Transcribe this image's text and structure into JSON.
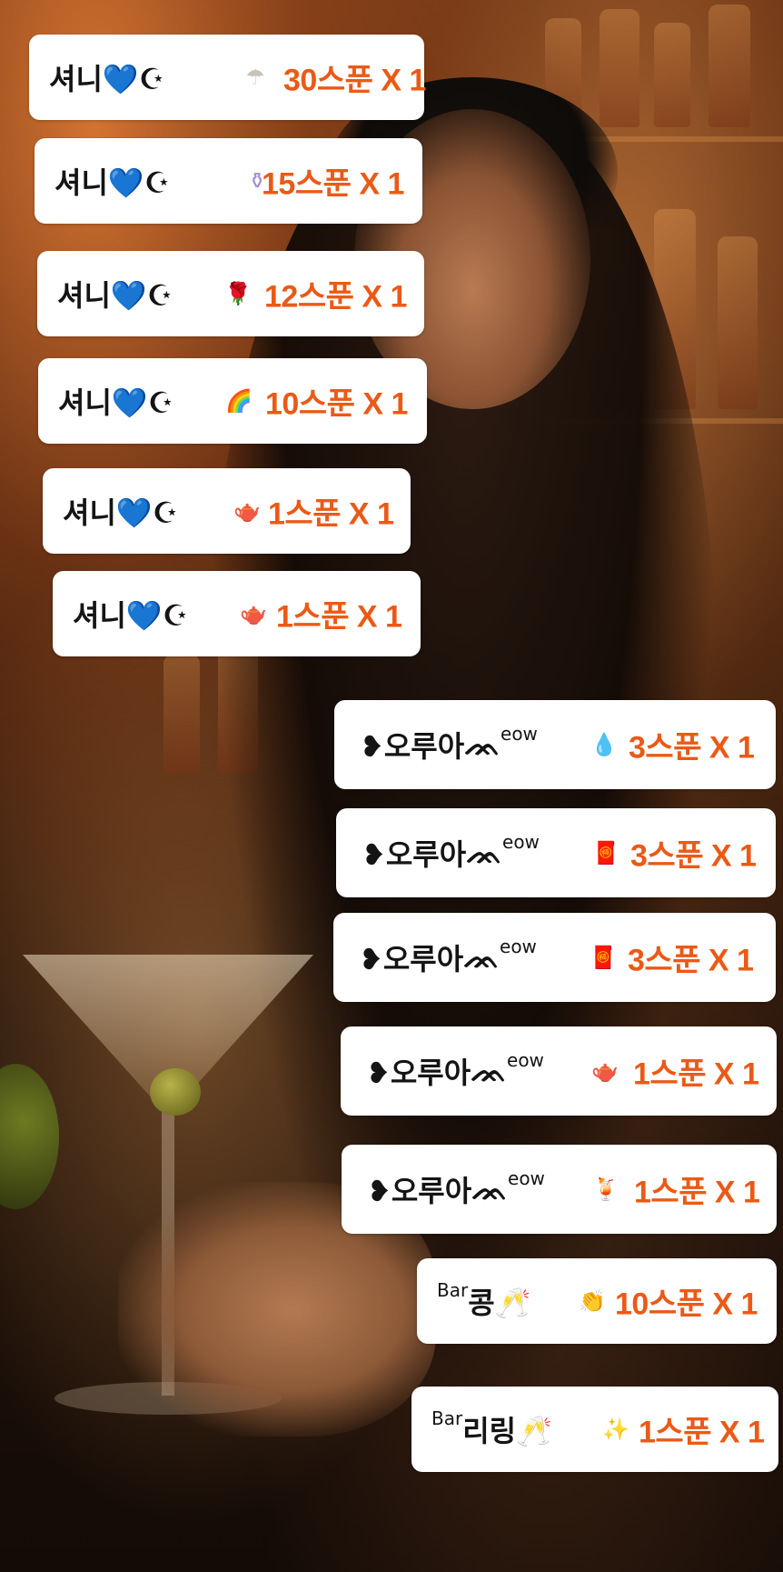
{
  "donations": [
    {
      "user": "셔니💙☪",
      "gift_icon": "umbrella-icon",
      "gift_glyph": "☂",
      "gift_color": "#c9c2b8",
      "amount": "30스푼 X 1"
    },
    {
      "user": "셔니💙☪",
      "gift_icon": "potion-bottle-icon",
      "gift_glyph": "⚱",
      "gift_color": "#9f8fd6",
      "amount": "15스푼 X 1"
    },
    {
      "user": "셔니💙☪",
      "gift_icon": "rose-icon",
      "gift_glyph": "🌹",
      "gift_color": "#a35ab4",
      "amount": "12스푼 X 1"
    },
    {
      "user": "셔니💙☪",
      "gift_icon": "rainbow-cloud-icon",
      "gift_glyph": "🌈",
      "gift_color": "#e87aa6",
      "amount": "10스푼 X 1"
    },
    {
      "user": "셔니💙☪",
      "gift_icon": "golden-teapot-icon",
      "gift_glyph": "🫖",
      "gift_color": "#d4a41f",
      "amount": "1스푼 X 1"
    },
    {
      "user": "셔니💙☪",
      "gift_icon": "golden-teapot-icon",
      "gift_glyph": "🫖",
      "gift_color": "#d4a41f",
      "amount": "1스푼 X 1"
    },
    {
      "user_prefix": "❥오루아",
      "user_deco": "ᨏ",
      "user_sup": "eow",
      "gift_icon": "water-drop-icon",
      "gift_glyph": "💧",
      "gift_color": "#a9d6ef",
      "amount": "3스푼 X 1"
    },
    {
      "user_prefix": "❥오루아",
      "user_deco": "ᨏ",
      "user_sup": "eow",
      "gift_icon": "red-envelope-icon",
      "gift_glyph": "🧧",
      "gift_color": "#d8262d",
      "amount": "3스푼 X 1"
    },
    {
      "user_prefix": "❥오루아",
      "user_deco": "ᨏ",
      "user_sup": "eow",
      "gift_icon": "red-envelope-icon",
      "gift_glyph": "🧧",
      "gift_color": "#d8262d",
      "amount": "3스푼 X 1"
    },
    {
      "user_prefix": "❥오루아",
      "user_deco": "ᨏ",
      "user_sup": "eow",
      "gift_icon": "golden-teapot-icon",
      "gift_glyph": "🫖",
      "gift_color": "#d4a41f",
      "amount": "1스푼 X 1"
    },
    {
      "user_prefix": "❥오루아",
      "user_deco": "ᨏ",
      "user_sup": "eow",
      "gift_icon": "orange-drink-icon",
      "gift_glyph": "🍹",
      "gift_color": "#f29a1d",
      "amount": "1스푼 X 1"
    },
    {
      "user_sup_pre": "Bar",
      "user_main": "콩🥂",
      "gift_icon": "clapping-hands-icon",
      "gift_glyph": "👏",
      "gift_color": "#e9b987",
      "amount": "10스푼 X 1"
    },
    {
      "user_sup_pre": "Bar",
      "user_main": "리링🥂",
      "gift_icon": "sparkle-star-icon",
      "gift_glyph": "✨",
      "gift_color": "#f1c94a",
      "amount": "1스푼 X 1"
    }
  ]
}
